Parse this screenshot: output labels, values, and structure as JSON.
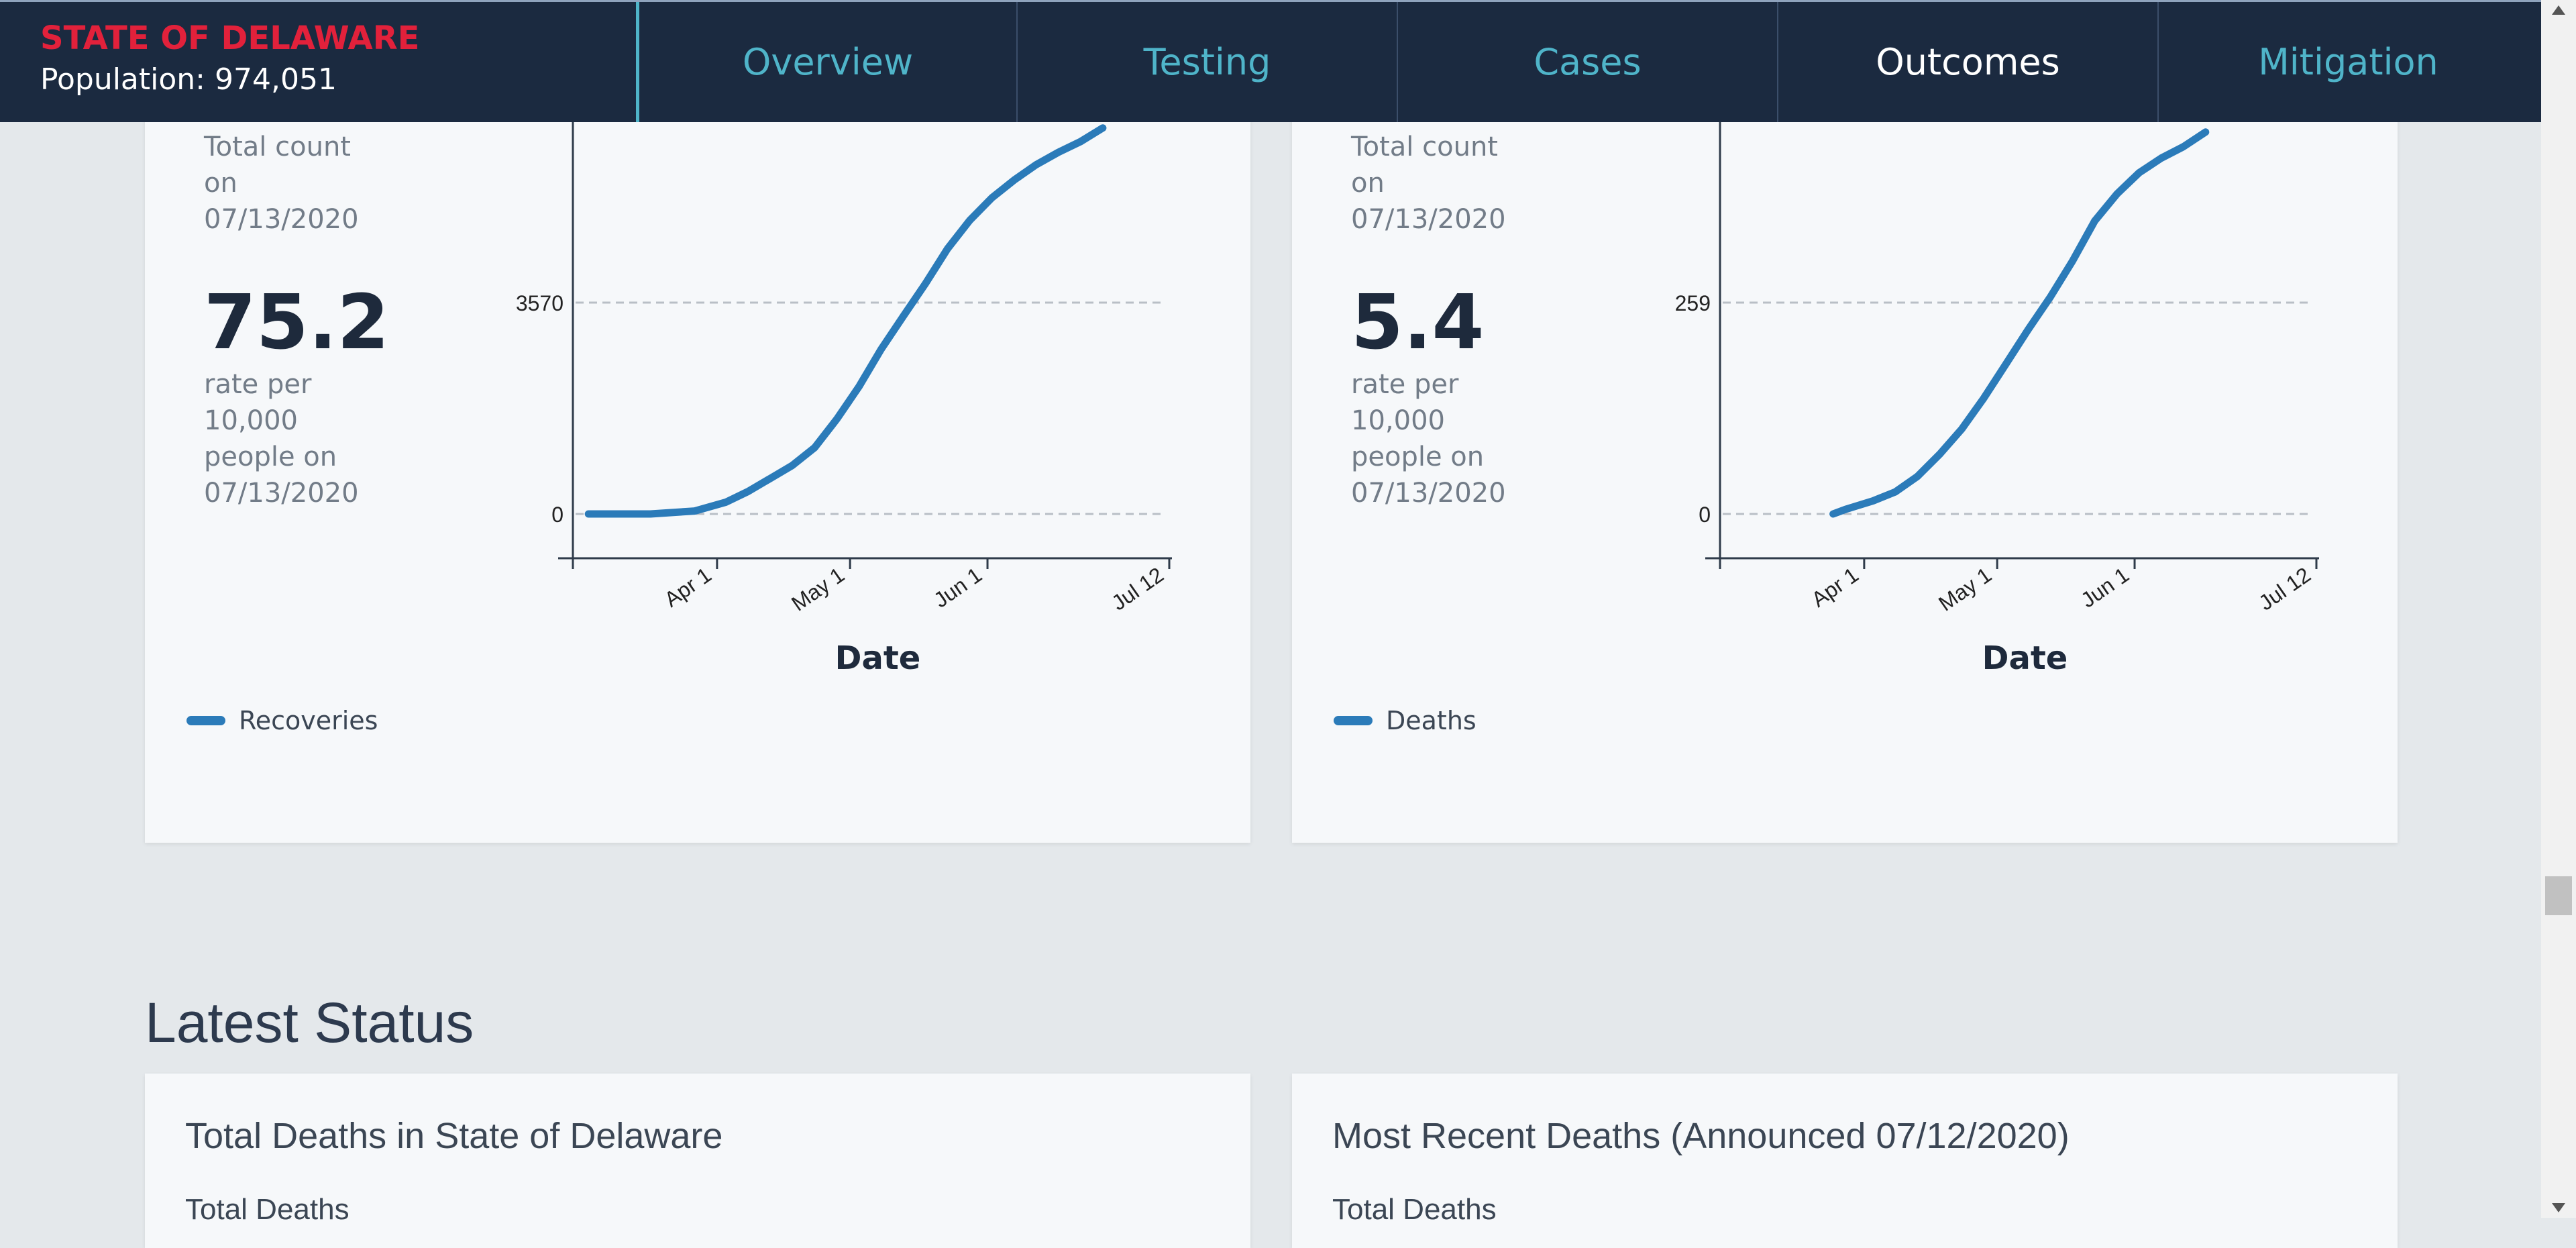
{
  "header": {
    "state_title": "STATE OF DELAWARE",
    "population": "Population: 974,051",
    "tabs": [
      {
        "label": "Overview"
      },
      {
        "label": "Testing"
      },
      {
        "label": "Cases"
      },
      {
        "label": "Outcomes"
      },
      {
        "label": "Mitigation"
      }
    ],
    "active_tab": "Outcomes"
  },
  "recoveries_card": {
    "caption": "Total count on 07/13/2020",
    "rate_value": "75.2",
    "rate_caption": "rate per 10,000 people on 07/13/2020",
    "legend": "Recoveries"
  },
  "deaths_card": {
    "caption": "Total count on 07/13/2020",
    "rate_value": "5.4",
    "rate_caption": "rate per 10,000 people on 07/13/2020",
    "legend": "Deaths"
  },
  "chart_data": [
    {
      "type": "line",
      "xlabel": "Date",
      "ylabel": "",
      "x_ticks": [
        "Apr 1",
        "May 1",
        "Jun 1",
        "Jul 12"
      ],
      "y_ticks": [
        0,
        3570
      ],
      "grid": true,
      "color": "#2b7bb9",
      "series": [
        {
          "name": "Recoveries",
          "x": [
            "2020-03-03",
            "2020-03-17",
            "2020-03-27",
            "2020-04-03",
            "2020-04-08",
            "2020-04-13",
            "2020-04-18",
            "2020-04-23",
            "2020-04-28",
            "2020-05-03",
            "2020-05-08",
            "2020-05-13",
            "2020-05-18",
            "2020-05-23",
            "2020-05-28",
            "2020-06-02",
            "2020-06-07",
            "2020-06-12",
            "2020-06-17",
            "2020-06-22",
            "2020-06-27"
          ],
          "y": [
            0,
            0,
            50,
            200,
            380,
            600,
            820,
            1120,
            1600,
            2150,
            2780,
            3340,
            3890,
            4480,
            4960,
            5340,
            5640,
            5900,
            6110,
            6290,
            6520
          ]
        }
      ]
    },
    {
      "type": "line",
      "xlabel": "Date",
      "ylabel": "",
      "x_ticks": [
        "Apr 1",
        "May 1",
        "Jun 1",
        "Jul 12"
      ],
      "y_ticks": [
        0,
        259
      ],
      "grid": true,
      "color": "#2b7bb9",
      "series": [
        {
          "name": "Deaths",
          "x": [
            "2020-03-25",
            "2020-03-28",
            "2020-04-03",
            "2020-04-08",
            "2020-04-13",
            "2020-04-18",
            "2020-04-23",
            "2020-04-28",
            "2020-05-03",
            "2020-05-08",
            "2020-05-13",
            "2020-05-18",
            "2020-05-23",
            "2020-05-28",
            "2020-06-02",
            "2020-06-07",
            "2020-06-12",
            "2020-06-17"
          ],
          "y": [
            0,
            6,
            16,
            27,
            46,
            73,
            104,
            142,
            184,
            226,
            266,
            310,
            359,
            392,
            418,
            436,
            450,
            468
          ]
        }
      ]
    }
  ],
  "latest_status": {
    "title": "Latest Status",
    "left_card_title": "Total Deaths in State of Delaware",
    "left_card_sub": "Total Deaths",
    "right_card_title": "Most Recent Deaths (Announced 07/12/2020)",
    "right_card_sub": "Total Deaths"
  }
}
